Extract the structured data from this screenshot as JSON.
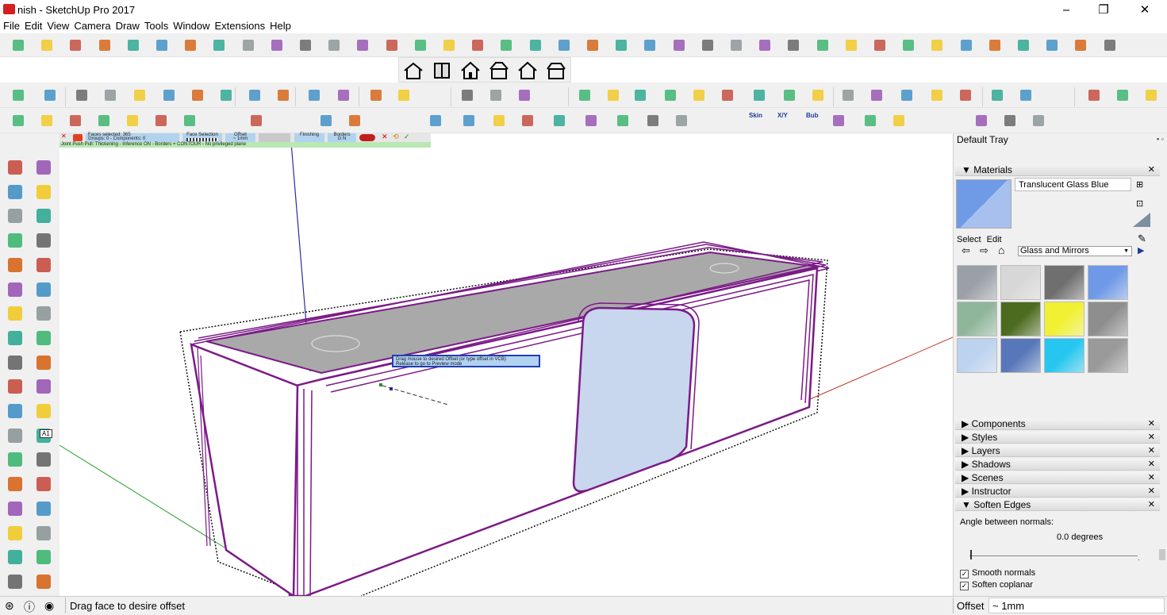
{
  "window": {
    "title": "nish - SketchUp Pro 2017",
    "minimize": "‒",
    "maximize": "❐",
    "close": "✕"
  },
  "menu": [
    "File",
    "Edit",
    "View",
    "Camera",
    "Draw",
    "Tools",
    "Window",
    "Extensions",
    "Help"
  ],
  "plugin_toolbar": {
    "faces_selected": "Faces selected: 365",
    "groups": "Groups: 0 - Components: 0",
    "face_selection": "Face Selection",
    "offset_label": "Offset",
    "offset_value": "~ 1mm",
    "finishing": "Finishing",
    "borders": "Borders",
    "letters": "G N",
    "status_line": "Joint Push Pull: Thickening - Inference ON - Borders = CONTOUR - No privileged plane"
  },
  "tooltip": {
    "line1": "Drag mouse to desired Offset (or type offset in VCB)",
    "line2": "Release to go to Preview mode"
  },
  "tray": {
    "title": "Default Tray",
    "materials": {
      "header": "Materials",
      "name": "Translucent Glass Blue",
      "tab_select": "Select",
      "tab_edit": "Edit",
      "library": "Glass and Mirrors",
      "swatches": [
        "#9aa0a6",
        "#d7d7d7",
        "#6f6f6f",
        "#6e99e8",
        "#8fb59a",
        "#4c6b1e",
        "#f2f032",
        "#8e8e8e",
        "#bcd3ef",
        "#5777b8",
        "#25c6ef",
        "#9a9a9a"
      ]
    },
    "sections": [
      "Components",
      "Styles",
      "Layers",
      "Shadows",
      "Scenes",
      "Instructor",
      "Soften Edges"
    ],
    "soften": {
      "angle_label": "Angle between normals:",
      "angle_value": "0.0  degrees",
      "smooth_label": "Smooth normals",
      "coplanar_label": "Soften coplanar",
      "check": "✓"
    }
  },
  "toolbar_texts": {
    "skin": "Skin",
    "xy": "X/Y",
    "bub": "Bub",
    "a1": "A1"
  },
  "status": {
    "hint": "Drag face to desire offset",
    "vcb_label": "Offset",
    "vcb_value": "~ 1mm"
  },
  "colors": {
    "edge_selected": "#7b1a87",
    "axis_red": "#c0392b",
    "axis_green": "#29a329",
    "axis_blue": "#2c2ca0",
    "glass": "#c8d6ee"
  }
}
